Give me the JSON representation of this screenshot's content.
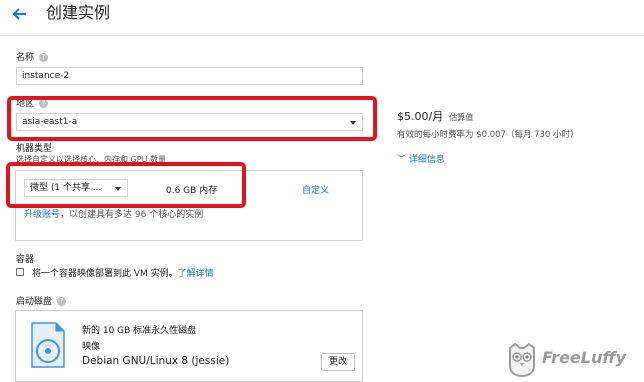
{
  "header": {
    "title": "创建实例"
  },
  "name": {
    "label": "名称",
    "value": "instance-2"
  },
  "zone": {
    "label": "地区",
    "value": "asia-east1-a"
  },
  "machine_type": {
    "label": "机器类型",
    "hint": "选择自定义以选择核心、内存和 GPU 数量",
    "selected": "微型 (1 个共享 ...",
    "memory": "0.6 GB 内存",
    "custom_link": "自定义",
    "upgrade_link": "升级账号",
    "upgrade_text": "，以创建具有多达 96 个核心的实例"
  },
  "pricing": {
    "price": "$5.00/月",
    "estimate_label": "估算值",
    "hourly": "有效的每小时费率为 $0.007（每月 730 小时）",
    "details_link": "详细信息"
  },
  "container": {
    "label": "容器",
    "checkbox_text": "将一个容器映像部署到此 VM 实例。",
    "learn_more": "了解详情"
  },
  "boot_disk": {
    "label": "启动磁盘",
    "line1": "新的 10 GB 标准永久性磁盘",
    "line2": "映像",
    "image": "Debian GNU/Linux 8 (jessie)",
    "change_button": "更改"
  },
  "watermark": {
    "text": "FreeLuffy"
  },
  "colors": {
    "accent": "#1a73e8",
    "highlight": "#e0141e"
  }
}
